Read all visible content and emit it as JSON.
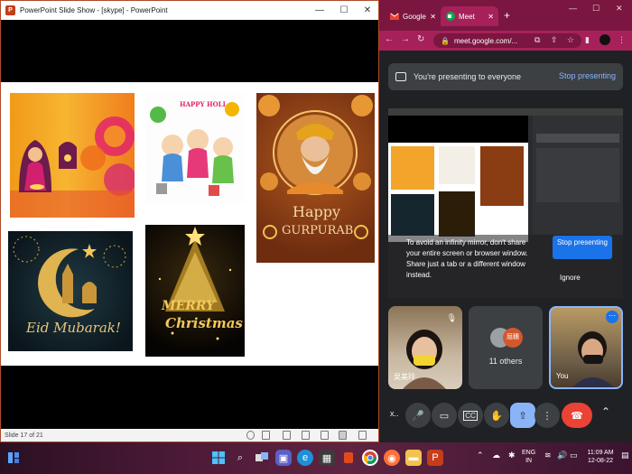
{
  "powerpoint": {
    "title": "PowerPoint Slide Show - [skype] - PowerPoint",
    "slide_status": "Slide 17 of 21",
    "window_controls": {
      "minimize": "—",
      "maximize": "☐",
      "close": "✕"
    },
    "slide": {
      "holi_caption": "HAPPY HOLI",
      "gurpurab_line1": "Happy",
      "gurpurab_line2": "GURPURAB",
      "eid_caption": "Eid Mubarak!",
      "christmas_line1": "MERRY",
      "christmas_line2": "Christmas"
    }
  },
  "chrome": {
    "tabs": [
      {
        "label": "Google",
        "icon": "gmail-icon"
      },
      {
        "label": "Meet",
        "icon": "meet-icon"
      }
    ],
    "new_tab": "+",
    "url": "meet.google.com/...",
    "window_controls": {
      "minimize": "—",
      "maximize": "☐",
      "close": "✕"
    },
    "accent_color": "#a62159"
  },
  "meet": {
    "presenting_text": "You're presenting to everyone",
    "stop_presenting_link": "Stop presenting",
    "mirror_warning": "To avoid an infinity mirror, don't share your entire screen or browser window. Share just a tab or a different window instead.",
    "stop_presenting_button": "Stop presenting",
    "ignore_button": "Ignore",
    "participants": [
      {
        "name": "吴美玲"
      },
      {
        "name": "11 others",
        "avatar_text": "屈穗"
      },
      {
        "name": "You"
      }
    ],
    "controls_more": "x.."
  },
  "taskbar": {
    "language_line1": "ENG",
    "language_line2": "IN",
    "time": "11:09 AM",
    "date": "12-08-22"
  }
}
